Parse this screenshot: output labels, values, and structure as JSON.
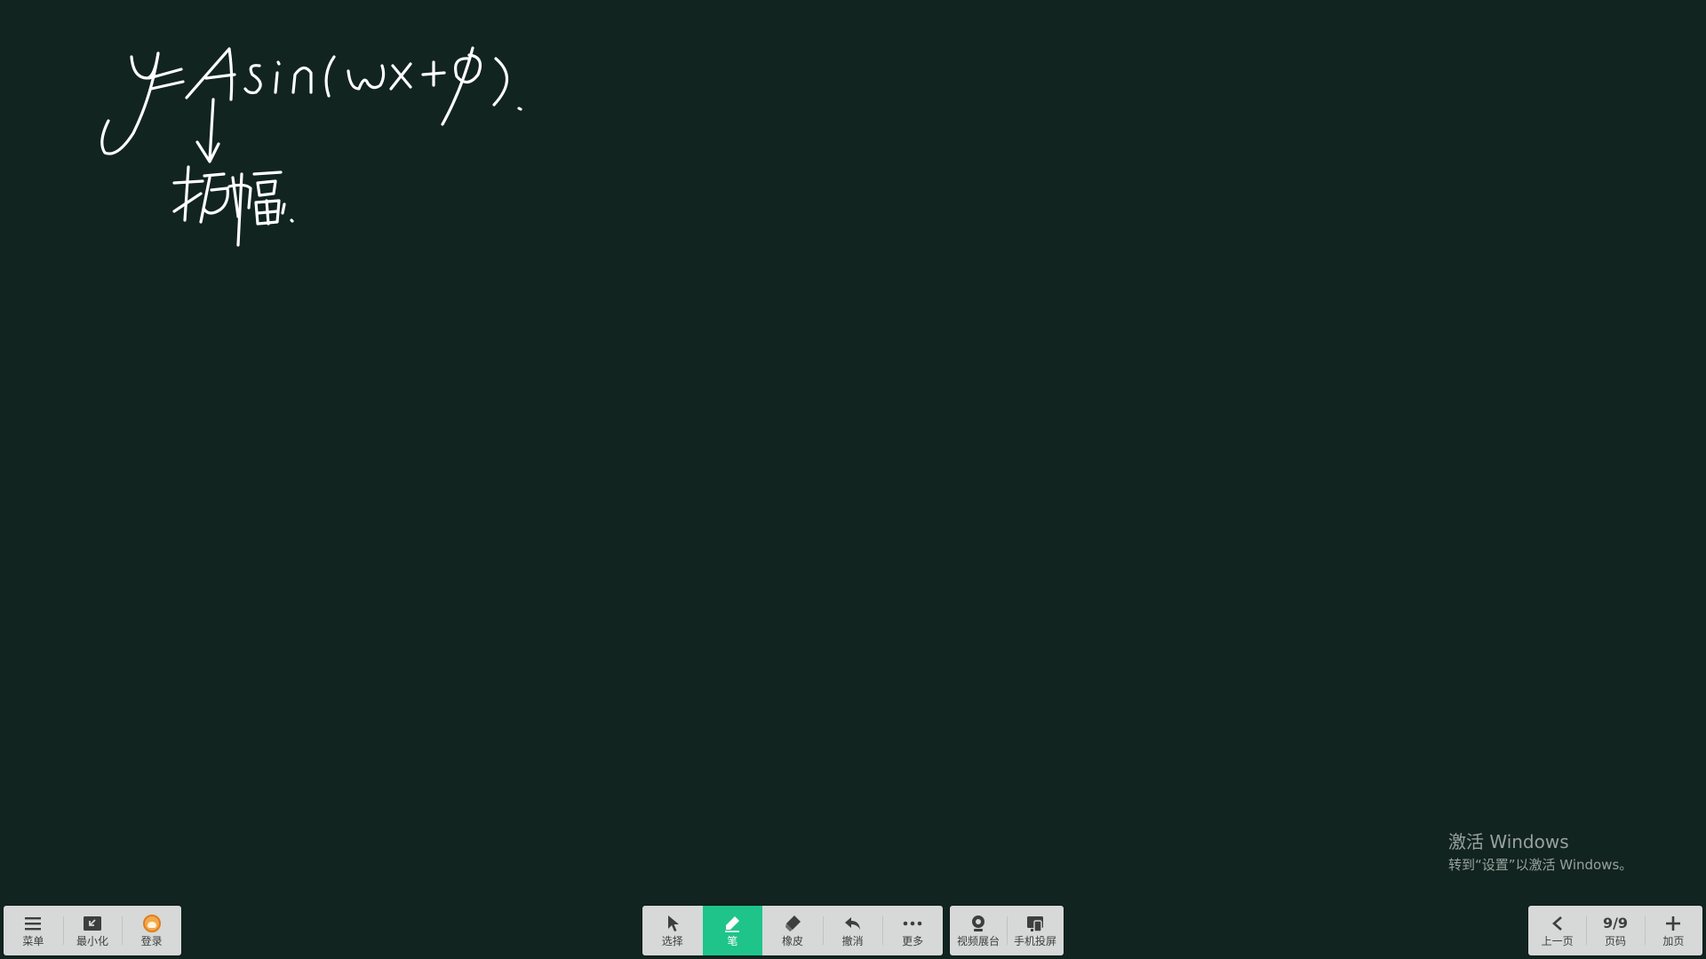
{
  "canvas": {
    "background": "#11241f",
    "ink_color": "#ffffff",
    "handwriting": [
      "y=Asin(wx+φ)",
      "振幅"
    ]
  },
  "watermark": {
    "title": "激活 Windows",
    "subtitle": "转到“设置”以激活 Windows。"
  },
  "toolbar_left": [
    {
      "label": "菜单",
      "icon": "menu-icon"
    },
    {
      "label": "最小化",
      "icon": "minimize-icon"
    },
    {
      "label": "登录",
      "icon": "avatar-icon"
    }
  ],
  "toolbar_center": [
    {
      "label": "选择",
      "icon": "cursor-icon"
    },
    {
      "label": "笔",
      "icon": "pen-icon",
      "active": true
    },
    {
      "label": "橡皮",
      "icon": "eraser-icon"
    },
    {
      "label": "撤消",
      "icon": "undo-icon"
    },
    {
      "label": "更多",
      "icon": "more-icon"
    }
  ],
  "toolbar_screen": [
    {
      "label": "视频展台",
      "icon": "camera-icon"
    },
    {
      "label": "手机投屏",
      "icon": "phone-cast-icon"
    }
  ],
  "toolbar_right": {
    "prev": {
      "label": "上一页",
      "icon": "chevron-left-icon"
    },
    "page": {
      "value": "9/9",
      "label": "页码"
    },
    "add": {
      "label": "加页",
      "icon": "plus-icon"
    }
  },
  "colors": {
    "active": "#1fc48a",
    "toolbar_bg": "#d6d9d8",
    "icon": "#3c3f3e"
  }
}
